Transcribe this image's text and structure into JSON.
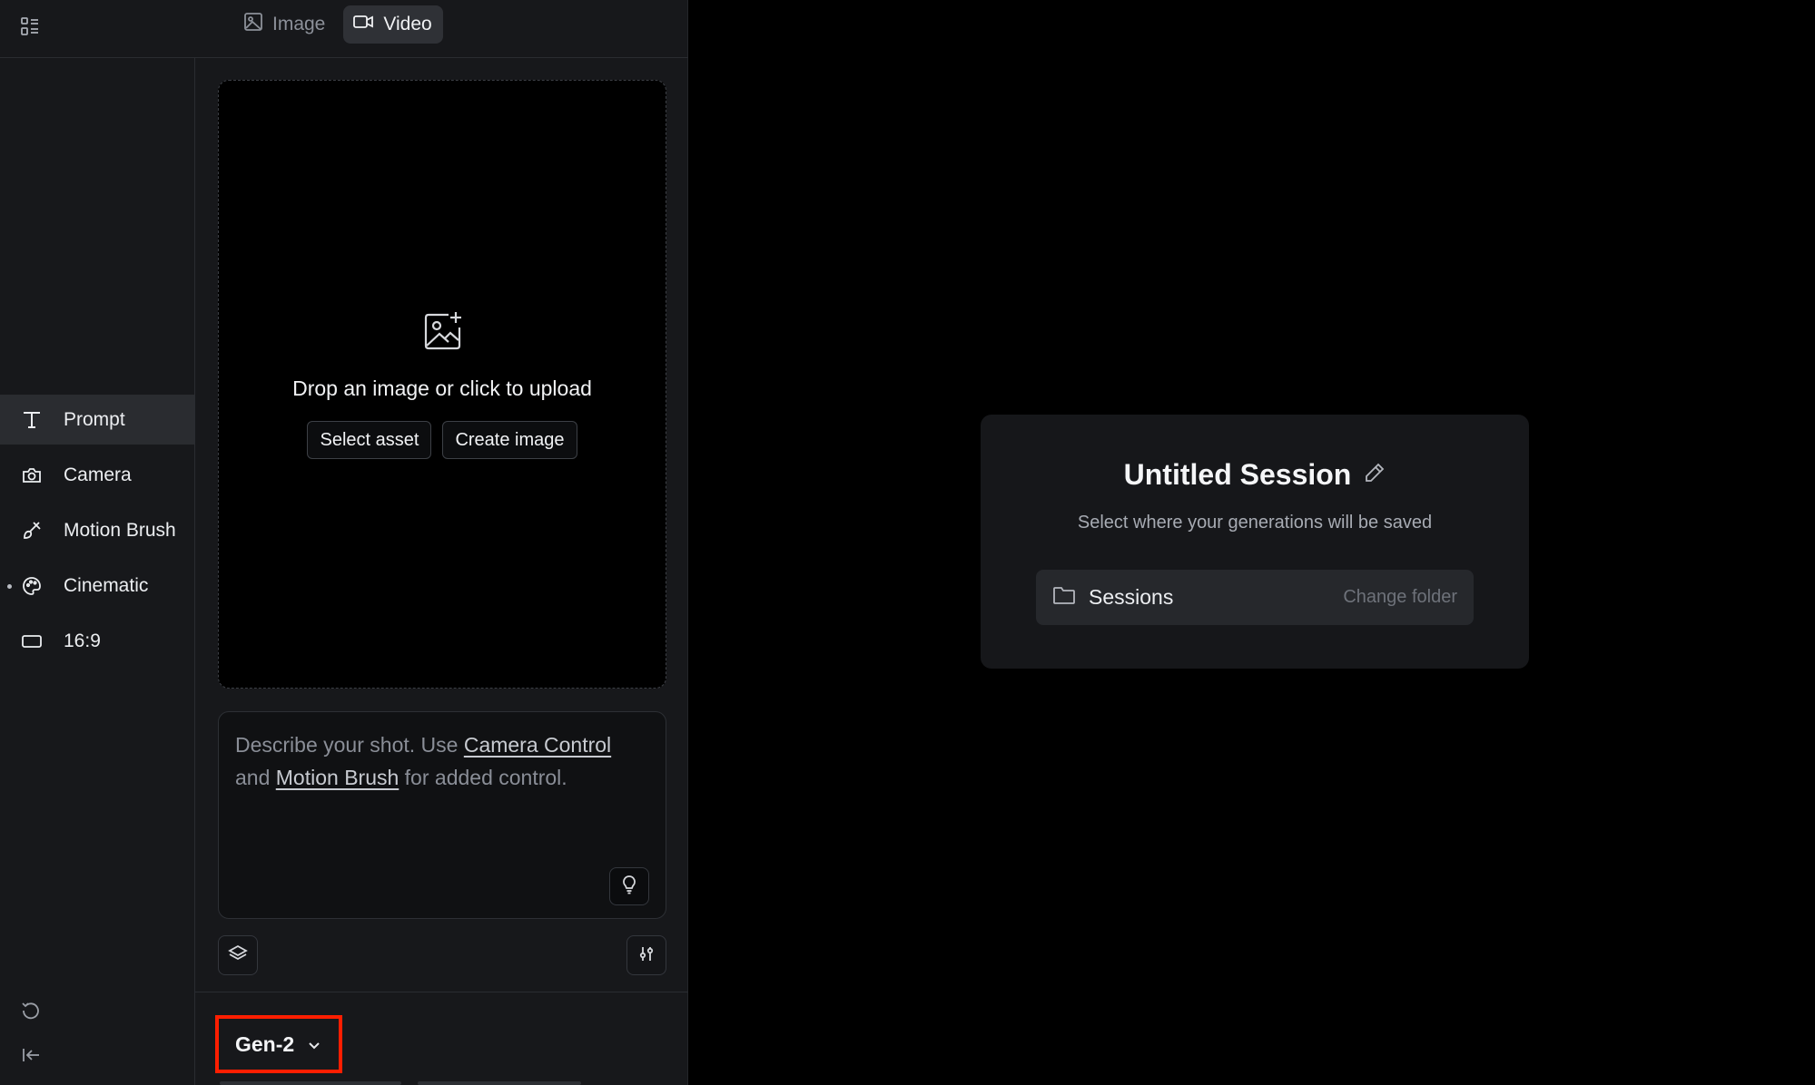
{
  "topbar": {
    "tabs": [
      {
        "label": "Image",
        "icon": "image-icon",
        "active": false
      },
      {
        "label": "Video",
        "icon": "video-camera-icon",
        "active": true
      }
    ]
  },
  "tools": [
    {
      "label": "Prompt",
      "icon": "text-icon",
      "active": true,
      "dot": false
    },
    {
      "label": "Camera",
      "icon": "camera-icon",
      "active": false,
      "dot": false
    },
    {
      "label": "Motion Brush",
      "icon": "brush-icon",
      "active": false,
      "dot": false
    },
    {
      "label": "Cinematic",
      "icon": "palette-icon",
      "active": false,
      "dot": true
    },
    {
      "label": "16:9",
      "icon": "aspect-ratio-icon",
      "active": false,
      "dot": false
    }
  ],
  "upload": {
    "text": "Drop an image or click to upload",
    "select_asset": "Select asset",
    "create_image": "Create image"
  },
  "prompt": {
    "placeholder_part1": "Describe your shot. Use ",
    "link1": "Camera Control",
    "placeholder_part2": " and ",
    "link2": "Motion Brush",
    "placeholder_part3": " for added control."
  },
  "model": {
    "selected": "Gen-2"
  },
  "session": {
    "title": "Untitled Session",
    "subtitle": "Select where your generations will be saved",
    "folder": "Sessions",
    "change_folder": "Change folder"
  },
  "colors": {
    "highlight": "#ff1e00",
    "panel": "#17181b",
    "card": "#16171a"
  }
}
